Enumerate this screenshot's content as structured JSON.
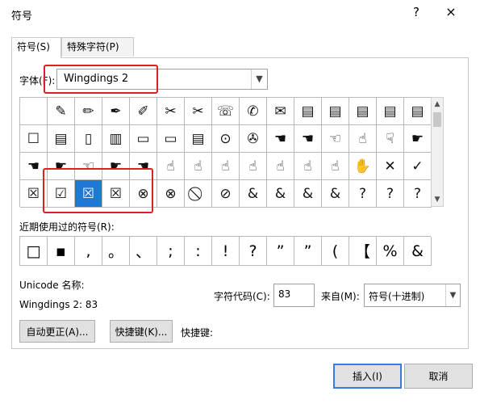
{
  "dialog": {
    "title": "符号",
    "help": "?",
    "close": "×"
  },
  "tabs": [
    {
      "label": "符号(S)"
    },
    {
      "label": "特殊字符(P)"
    }
  ],
  "font": {
    "label": "字体(F):",
    "value": "Wingdings 2"
  },
  "symbols": [
    "",
    "✎",
    "✏",
    "✒",
    "✐",
    "✂",
    "✂",
    "☏",
    "✆",
    "✉",
    "▤",
    "▤",
    "▤",
    "▤",
    "▤",
    "☐",
    "▤",
    "▯",
    "▥",
    "▭",
    "▭",
    "▤",
    "⊙",
    "✇",
    "☚",
    "☚",
    "☜",
    "☝",
    "☟",
    "☛",
    "☚",
    "☛",
    "☜",
    "☛",
    "☚",
    "☝",
    "☝",
    "☝",
    "☝",
    "☝",
    "☝",
    "☝",
    "✋",
    "✕",
    "✓",
    "☒",
    "☑",
    "☒",
    "☒",
    "⊗",
    "⊗",
    "⃠",
    "⊘",
    "&",
    "&",
    "&",
    "&",
    "?",
    "?",
    "?"
  ],
  "recent": {
    "label": "近期使用过的符号(R):",
    "items": [
      "□",
      "▪",
      ",",
      "。",
      "、",
      ";",
      ":",
      "!",
      "?",
      "”",
      "”",
      "(",
      "【",
      "%",
      "&"
    ]
  },
  "unicode": {
    "label": "Unicode 名称:",
    "value": "Wingdings 2: 83"
  },
  "code": {
    "label": "字符代码(C):",
    "value": "83"
  },
  "from": {
    "label": "来自(M):",
    "value": "符号(十进制)"
  },
  "buttons": {
    "autocorrect": "自动更正(A)...",
    "shortcut_key": "快捷键(K)...",
    "shortcut_label": "快捷键:",
    "insert": "插入(I)",
    "cancel": "取消"
  },
  "colors": {
    "highlight": "#1e78d4",
    "annotation": "#e02020"
  }
}
